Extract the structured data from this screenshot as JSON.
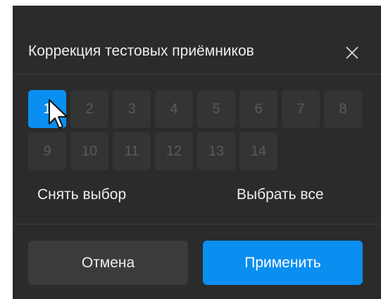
{
  "dialog": {
    "title": "Коррекция тестовых приёмников",
    "close_icon": "close-icon",
    "selected_channel": "1"
  },
  "channels": [
    "1",
    "2",
    "3",
    "4",
    "5",
    "6",
    "7",
    "8",
    "9",
    "10",
    "11",
    "12",
    "13",
    "14"
  ],
  "actions": {
    "deselect_label": "Снять выбор",
    "select_all_label": "Выбрать все"
  },
  "buttons": {
    "cancel_label": "Отмена",
    "apply_label": "Применить"
  },
  "colors": {
    "accent": "#0a8ef0",
    "panel": "#2b2b2b",
    "cell": "#343434",
    "cell_text_disabled": "#5a5a5a",
    "text": "#eeeeee"
  }
}
